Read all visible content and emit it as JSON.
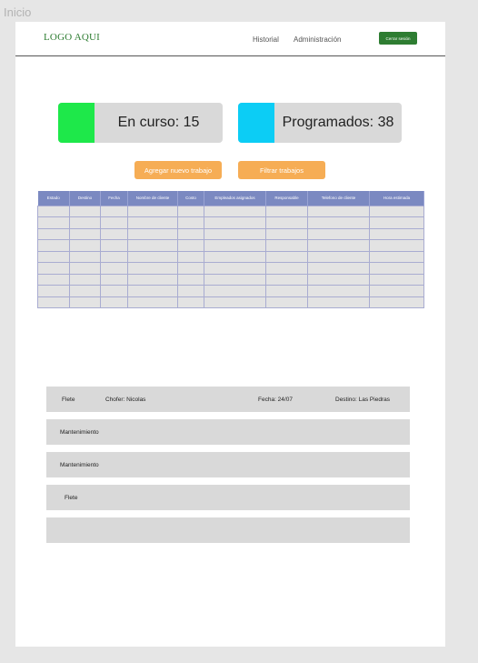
{
  "frame_label": "Inicio",
  "header": {
    "logo": "LOGO AQUI",
    "nav": [
      "Historial",
      "Administración"
    ],
    "logout_label": "Cerrar sesión"
  },
  "stats": [
    {
      "label": "En curso: 15",
      "color": "#1ee84a"
    },
    {
      "label": "Programados: 38",
      "color": "#0ccdf5"
    }
  ],
  "actions": {
    "add_label": "Agregar nuevo trabajo",
    "filter_label": "Filtrar trabajos"
  },
  "table": {
    "columns": [
      "Estado",
      "Destino",
      "Fecha",
      "Nombre de cliente",
      "Costo",
      "Empleados asignados",
      "Responsable",
      "Telefono de cliente",
      "Hora estimada"
    ],
    "empty_rows": 9
  },
  "jobs": [
    {
      "type": "Flete",
      "driver": "Chofer: Nicolas",
      "date": "Fecha: 24/07",
      "destination": "Destino: Las Piedras"
    },
    {
      "type": "Mantenimiento"
    },
    {
      "type": "Mantenimiento"
    },
    {
      "type": "Flete"
    },
    {
      "type": ""
    }
  ]
}
